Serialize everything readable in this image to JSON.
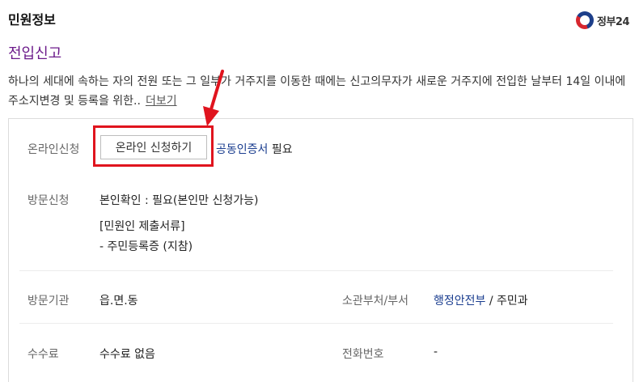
{
  "header": {
    "title": "민원정보",
    "logo_text": "정부24"
  },
  "service": {
    "title": "전입신고",
    "description": "하나의 세대에 속하는 자의 전원 또는 그 일부가 거주지를 이동한 때에는 신고의무자가 새로운 거주지에 전입한 날부터 14일 이내에 주소지변경 및 등록을 위한..",
    "more_link": "더보기"
  },
  "online": {
    "label": "온라인신청",
    "button_label": "온라인 신청하기",
    "cert_link": "공동인증서",
    "cert_suffix": "필요"
  },
  "visit": {
    "label": "방문신청",
    "identity": "본인확인 : 필요(본인만 신청가능)",
    "docs_header": "[민원인 제출서류]",
    "docs_item": "- 주민등록증 (지참)"
  },
  "agency": {
    "label": "방문기관",
    "value": "읍.면.동",
    "dept_label": "소관부처/부서",
    "dept_ministry": "행정안전부",
    "dept_divider": "/",
    "dept_division": "주민과"
  },
  "fee": {
    "label": "수수료",
    "value": "수수료 없음",
    "phone_label": "전화번호",
    "phone_value": "-"
  },
  "colors": {
    "service_title": "#6b1a8a",
    "link": "#1a3d8f",
    "highlight": "#e0141e"
  }
}
